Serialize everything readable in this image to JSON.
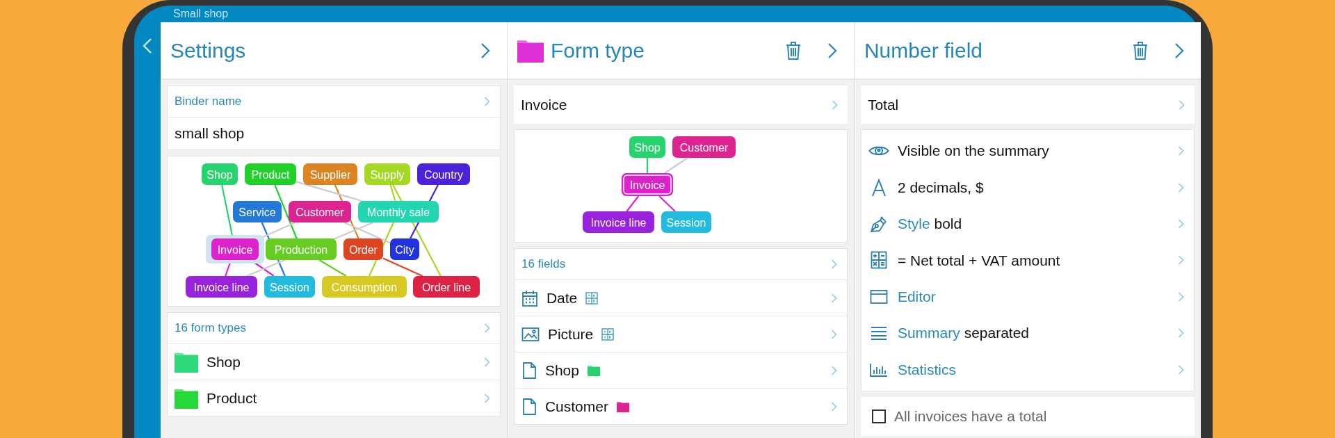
{
  "window": {
    "title": "Small shop"
  },
  "panels": [
    {
      "header": {
        "title": "Settings",
        "deletable": false
      },
      "cards": [
        {
          "kind": "labeled_value",
          "label": "Binder name",
          "value": "small shop"
        },
        {
          "kind": "overview_graph",
          "nodes": [
            {
              "label": "Shop",
              "color": "#27d36c",
              "selected": false
            },
            {
              "label": "Product",
              "color": "#22d02c",
              "selected": false
            },
            {
              "label": "Supplier",
              "color": "#dd8422",
              "selected": false
            },
            {
              "label": "Supply",
              "color": "#a5d822",
              "selected": false
            },
            {
              "label": "Country",
              "color": "#4b22d9",
              "selected": false
            },
            {
              "label": "Service",
              "color": "#2478d8",
              "selected": false
            },
            {
              "label": "Customer",
              "color": "#dd2490",
              "selected": false
            },
            {
              "label": "Monthly sale",
              "color": "#22d6b0",
              "selected": false
            },
            {
              "label": "Invoice",
              "color": "#dd22cc",
              "selected": true
            },
            {
              "label": "Production",
              "color": "#66cc22",
              "selected": false
            },
            {
              "label": "Order",
              "color": "#dd4422",
              "selected": false
            },
            {
              "label": "City",
              "color": "#2233dd",
              "selected": false
            },
            {
              "label": "Invoice line",
              "color": "#9922dd",
              "selected": false
            },
            {
              "label": "Session",
              "color": "#22bbdd",
              "selected": false
            },
            {
              "label": "Consumption",
              "color": "#d8c822",
              "selected": false
            },
            {
              "label": "Order line",
              "color": "#dd2244",
              "selected": false
            }
          ]
        },
        {
          "kind": "list",
          "header": "16 form types",
          "items": [
            {
              "kind": "folder",
              "color": "#2edb7c",
              "label": "Shop"
            },
            {
              "kind": "folder",
              "color": "#26d83a",
              "label": "Product"
            }
          ]
        }
      ]
    },
    {
      "header": {
        "title": "Form type",
        "color": "#e030d8",
        "deletable": true
      },
      "cards": [
        {
          "kind": "name",
          "value": "Invoice"
        },
        {
          "kind": "focus_graph",
          "nodes": [
            {
              "label": "Shop",
              "color": "#27d36c",
              "selected": false
            },
            {
              "label": "Customer",
              "color": "#dd2490",
              "selected": false
            },
            {
              "label": "Invoice",
              "color": "#dd22cc",
              "selected": true
            },
            {
              "label": "Invoice line",
              "color": "#9922dd",
              "selected": false
            },
            {
              "label": "Session",
              "color": "#22bbdd",
              "selected": false
            }
          ]
        },
        {
          "kind": "list",
          "header": "16 fields",
          "items": [
            {
              "kind": "date",
              "label": "Date",
              "tag": {
                "kind": "grid"
              }
            },
            {
              "kind": "picture",
              "label": "Picture",
              "tag": {
                "kind": "grid"
              }
            },
            {
              "kind": "link",
              "label": "Shop",
              "tag": {
                "kind": "folder",
                "color": "#27d36c"
              }
            },
            {
              "kind": "link",
              "label": "Customer",
              "tag": {
                "kind": "folder",
                "color": "#dd2490"
              }
            }
          ]
        }
      ]
    },
    {
      "header": {
        "title": "Number field",
        "deletable": true
      },
      "cards": [
        {
          "kind": "name",
          "value": "Total"
        },
        {
          "kind": "properties",
          "rows": [
            {
              "kind": "visibility",
              "value": "Visible on the summary"
            },
            {
              "kind": "format",
              "value": "2 decimals, $"
            },
            {
              "kind": "style",
              "label": "Style",
              "value": "bold"
            },
            {
              "kind": "formula",
              "value": "= Net total + VAT amount"
            },
            {
              "kind": "editor",
              "label": "Editor"
            },
            {
              "kind": "summary",
              "label": "Summary",
              "value": "separated"
            },
            {
              "kind": "statistics",
              "label": "Statistics"
            }
          ]
        },
        {
          "kind": "checkbox",
          "label": "All invoices have a total",
          "checked": false
        }
      ]
    }
  ]
}
